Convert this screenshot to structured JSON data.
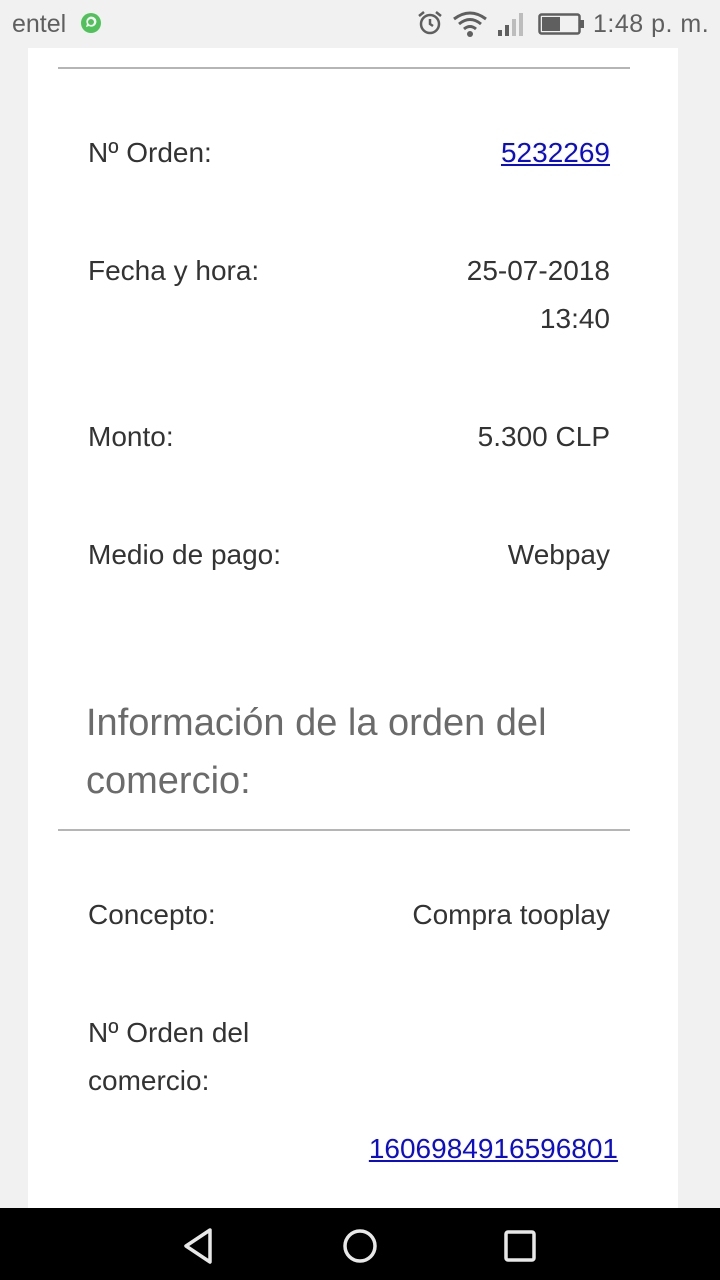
{
  "status_bar": {
    "carrier": "entel",
    "time": "1:48 p. m.",
    "icons": [
      "whatsapp-icon",
      "alarm-icon",
      "wifi-icon",
      "signal-icon",
      "battery-icon"
    ]
  },
  "order": {
    "number_label": "Nº Orden:",
    "number_value": "5232269",
    "date_label": "Fecha y hora:",
    "date_value": "25-07-2018",
    "time_value": "13:40",
    "amount_label": "Monto:",
    "amount_value": "5.300 CLP",
    "method_label": "Medio de pago:",
    "method_value": "Webpay"
  },
  "merchant": {
    "section_title": "Información de la orden del comercio:",
    "concept_label": "Concepto:",
    "concept_value": "Compra tooplay",
    "order_label_line1": "Nº Orden del",
    "order_label_line2": "comercio:",
    "order_value": "1606984916596801"
  },
  "nav_bar": {
    "icons": [
      "back-icon",
      "home-icon",
      "recent-apps-icon"
    ]
  },
  "colors": {
    "link": "#0b0bd8",
    "text": "#333333",
    "section_title": "#6b6b6b",
    "background": "#f1f1f1",
    "card": "#ffffff"
  }
}
